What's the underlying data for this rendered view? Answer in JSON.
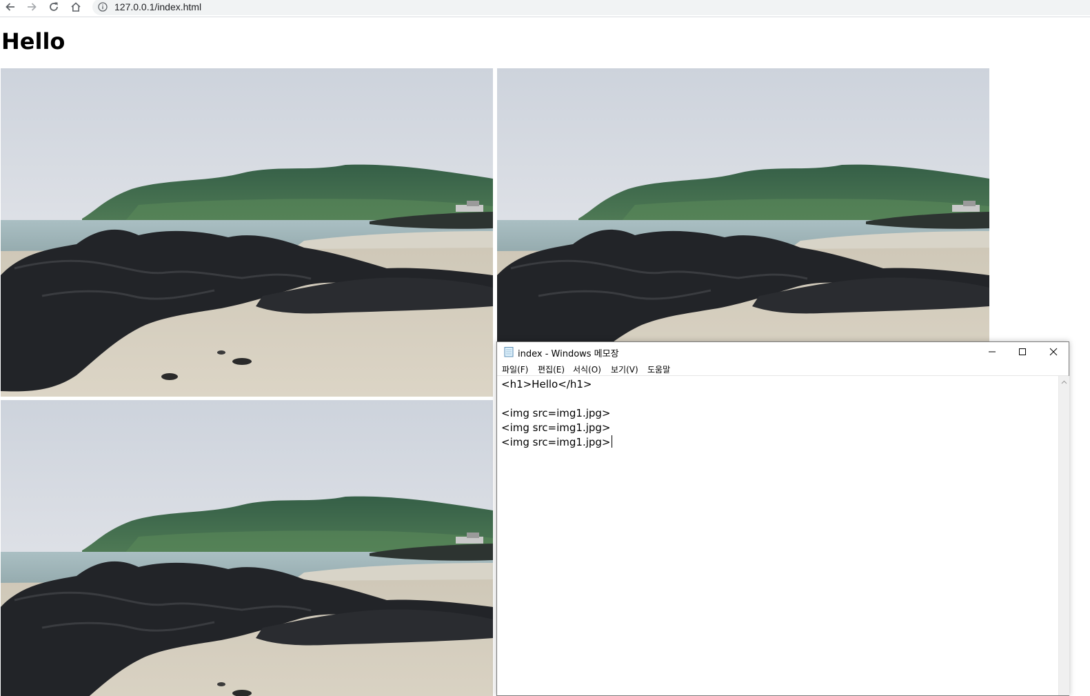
{
  "browser": {
    "url": "127.0.0.1/index.html",
    "back_icon": "arrow-left-icon",
    "forward_icon": "arrow-right-icon",
    "reload_icon": "reload-icon",
    "home_icon": "home-icon",
    "info_icon": "info-icon"
  },
  "page": {
    "heading": "Hello",
    "images": [
      {
        "src": "img1.jpg",
        "subject": "coastal-landscape"
      },
      {
        "src": "img1.jpg",
        "subject": "coastal-landscape"
      },
      {
        "src": "img1.jpg",
        "subject": "coastal-landscape"
      }
    ]
  },
  "notepad": {
    "title": "index - Windows 메모장",
    "minimize_icon": "minimize-icon",
    "maximize_icon": "maximize-icon",
    "close_icon": "close-icon",
    "menu": [
      "파일(F)",
      "편집(E)",
      "서식(O)",
      "보기(V)",
      "도움말"
    ],
    "lines": [
      "<h1>Hello</h1>",
      "",
      "<img src=img1.jpg>",
      "<img src=img1.jpg>",
      "<img src=img1.jpg>"
    ]
  },
  "colors": {
    "omnibox_bg": "#f1f3f4",
    "icon_gray": "#5f6368",
    "sky": "#dfe3e8",
    "hill": "#3f6b4e",
    "sea": "#a9bcbf",
    "rock": "#202226",
    "sand": "#d9d2c2"
  }
}
